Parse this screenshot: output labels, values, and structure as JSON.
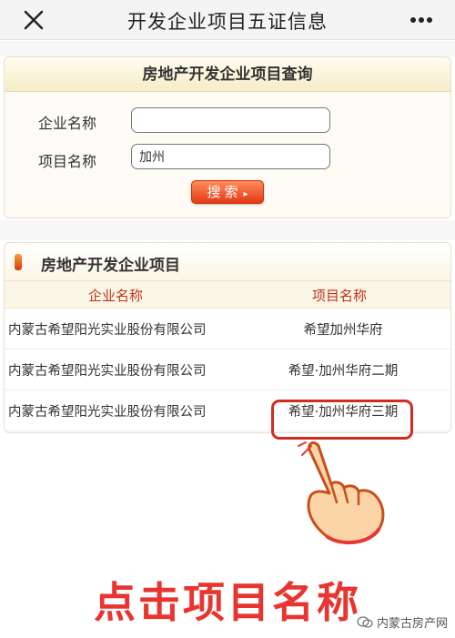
{
  "topbar": {
    "title": "开发企业项目五证信息",
    "close_icon": "close-icon",
    "more_icon": "more-icon"
  },
  "query": {
    "heading": "房地产开发企业项目查询",
    "company_label": "企业名称",
    "company_value": "",
    "project_label": "项目名称",
    "project_value": "加州",
    "search_label": "搜索",
    "search_arrow": "▸"
  },
  "results": {
    "heading": "房地产开发企业项目",
    "columns": {
      "company": "企业名称",
      "project": "项目名称"
    },
    "rows": [
      {
        "company": "内蒙古希望阳光实业股份有限公司",
        "project": "希望加州华府"
      },
      {
        "company": "内蒙古希望阳光实业股份有限公司",
        "project": "希望·加州华府二期"
      },
      {
        "company": "内蒙古希望阳光实业股份有限公司",
        "project": "希望·加州华府三期"
      }
    ]
  },
  "caption": "点击项目名称",
  "watermark": "内蒙古房产网",
  "colors": {
    "accent_red": "#e8352f",
    "header_red": "#c0341a",
    "button_orange": "#e33b16"
  }
}
